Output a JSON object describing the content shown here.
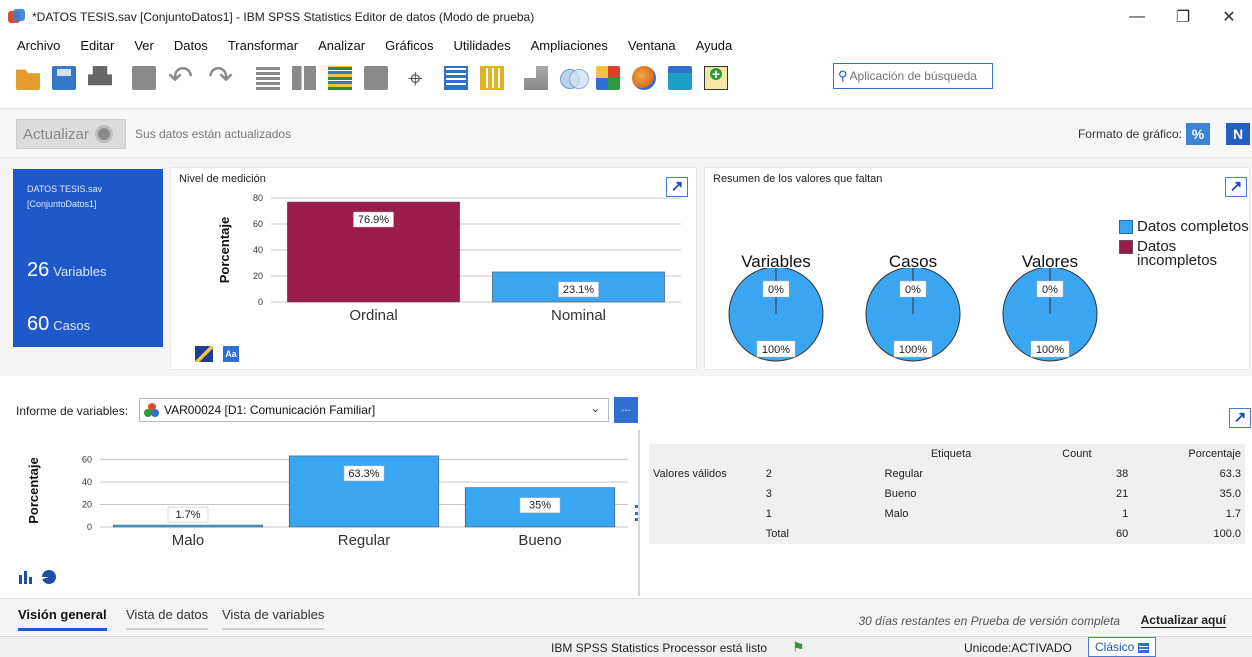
{
  "window": {
    "title": "*DATOS TESIS.sav [ConjuntoDatos1] - IBM SPSS Statistics Editor de datos (Modo de prueba)",
    "controls": {
      "minimize": "—",
      "restore": "❐",
      "close": "✕"
    }
  },
  "menu": [
    "Archivo",
    "Editar",
    "Ver",
    "Datos",
    "Transformar",
    "Analizar",
    "Gráficos",
    "Utilidades",
    "Ampliaciones",
    "Ventana",
    "Ayuda"
  ],
  "toolbar": {
    "icons": [
      "open-icon",
      "save-icon",
      "print-icon",
      "dialog-recall-icon",
      "undo-icon",
      "redo-icon",
      "goto-case-icon",
      "goto-variable-icon",
      "variables-icon",
      "run-descriptives-icon",
      "find-icon",
      "insert-cases-icon",
      "insert-variable-icon",
      "split-file-icon",
      "weight-cases-icon",
      "select-cases-icon",
      "value-labels-icon",
      "use-variable-sets-icon",
      "customize-icon"
    ],
    "search_placeholder": "Aplicación de búsqueda"
  },
  "refresh": {
    "button_label": "Actualizar",
    "status": "Sus datos están actualizados",
    "chart_format_label": "Formato de gráfico:",
    "percent_label": "%",
    "count_label": "N"
  },
  "dataset": {
    "name_line1": "DATOS TESIS.sav",
    "name_line2": "[ConjuntoDatos1]",
    "variables_count": "26",
    "variables_label": "Variables",
    "cases_count": "60",
    "cases_label": "Casos"
  },
  "measurement_panel": {
    "title": "Nivel de medición",
    "expand": "↗"
  },
  "missing_panel": {
    "title": "Resumen de los valores que faltan",
    "expand": "↗",
    "pie_titles": [
      "Variables",
      "Casos",
      "Valores"
    ],
    "incomplete_label": "0%",
    "complete_label": "100%",
    "legend_complete": "Datos completos",
    "legend_incomplete_1": "Datos",
    "legend_incomplete_2": "incompletos",
    "colors": {
      "complete": "#3aa5f0",
      "incomplete": "#9b1b4b"
    }
  },
  "variable_report": {
    "label": "Informe de variables:",
    "selected": "VAR00024  [D1: Comunicación Familiar]",
    "chevron": "⌄",
    "more": "...",
    "expand": "↗"
  },
  "frequency_table": {
    "header": {
      "label": "Etiqueta",
      "count": "Count",
      "percent": "Porcentaje"
    },
    "group_label": "Valores válidos",
    "rows": [
      {
        "value": "2",
        "label": "Regular",
        "count": "38",
        "percent": "63.3"
      },
      {
        "value": "3",
        "label": "Bueno",
        "count": "21",
        "percent": "35.0"
      },
      {
        "value": "1",
        "label": "Malo",
        "count": "1",
        "percent": "1.7"
      }
    ],
    "total": {
      "value": "Total",
      "count": "60",
      "percent": "100.0"
    }
  },
  "chart_data": [
    {
      "type": "bar",
      "ylabel": "Porcentaje",
      "categories": [
        "Ordinal",
        "Nominal"
      ],
      "values": [
        76.9,
        23.1
      ],
      "data_labels": [
        "76.9%",
        "23.1%"
      ],
      "colors": [
        "#9b1b4b",
        "#3aa5f0"
      ],
      "ylim": [
        0,
        80
      ],
      "yticks": [
        0,
        20,
        40,
        60,
        80
      ],
      "grid": true
    },
    {
      "type": "pie",
      "charts": [
        {
          "title": "Variables",
          "slices": [
            {
              "label": "Datos completos",
              "value": 100
            },
            {
              "label": "Datos incompletos",
              "value": 0
            }
          ]
        },
        {
          "title": "Casos",
          "slices": [
            {
              "label": "Datos completos",
              "value": 100
            },
            {
              "label": "Datos incompletos",
              "value": 0
            }
          ]
        },
        {
          "title": "Valores",
          "slices": [
            {
              "label": "Datos completos",
              "value": 100
            },
            {
              "label": "Datos incompletos",
              "value": 0
            }
          ]
        }
      ],
      "legend": "right"
    },
    {
      "type": "bar",
      "ylabel": "Porcentaje",
      "categories": [
        "Malo",
        "Regular",
        "Bueno"
      ],
      "values": [
        1.7,
        63.3,
        35
      ],
      "data_labels": [
        "1.7%",
        "63.3%",
        "35%"
      ],
      "colors": [
        "#3aa5f0",
        "#3aa5f0",
        "#3aa5f0"
      ],
      "ylim": [
        0,
        65
      ],
      "yticks": [
        0,
        20,
        40,
        60
      ],
      "grid": true
    }
  ],
  "tabs": [
    "Visión general",
    "Vista de datos",
    "Vista de variables"
  ],
  "trial": {
    "note": "30 días restantes en Prueba de versión completa",
    "link": "Actualizar aquí"
  },
  "status": {
    "processor": "IBM SPSS Statistics Processor está listo",
    "unicode": "Unicode:ACTIVADO",
    "mode": "Clásico"
  }
}
